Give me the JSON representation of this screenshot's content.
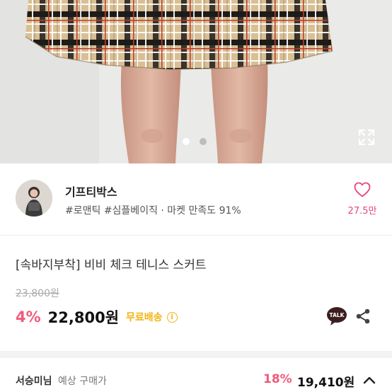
{
  "gallery": {
    "current_index": 1,
    "total_images": 2,
    "expand_icon": "expand-arrows-icon"
  },
  "seller": {
    "name": "기프티박스",
    "tags": "#로맨틱 #심플베이직 · 마켓 만족도 91%",
    "likes": "27.5만",
    "like_icon": "heart-outline-icon"
  },
  "product": {
    "name": "[속바지부착] 비비 체크 테니스 스커트",
    "original_price": "23,800원",
    "discount": "4%",
    "price": "22,800원",
    "shipping": "무료배송",
    "info_icon_text": "i",
    "talk_label": "TALK"
  },
  "member_price": {
    "member": "서승미님",
    "label": "예상 구매가",
    "discount": "18%",
    "price": "19,410원"
  },
  "colors": {
    "accent_pink": "#f05b7a",
    "shipping_yellow": "#f3b313",
    "talk_bubble": "#3c1e1e"
  }
}
